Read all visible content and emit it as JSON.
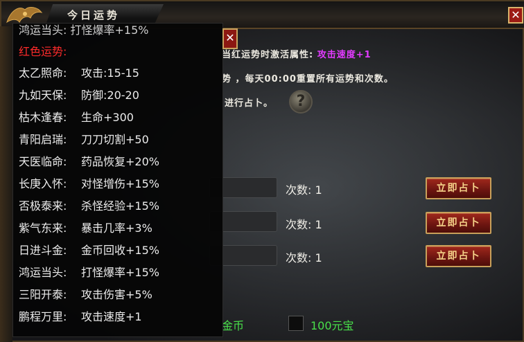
{
  "window": {
    "title": "今日运势",
    "close_symbol": "✕"
  },
  "description": {
    "line1_prefix": "当红运势时激活属性:",
    "line1_highlight": "攻击速度+1",
    "line2": "势 ，每天00:00重置所有运势和次数。",
    "line3": "进行占卜。",
    "help_symbol": "?"
  },
  "divination_rows": [
    {
      "count_label": "次数:",
      "count_value": "1",
      "button_label": "立即占卜"
    },
    {
      "count_label": "次数:",
      "count_value": "1",
      "button_label": "立即占卜"
    },
    {
      "count_label": "次数:",
      "count_value": "1",
      "button_label": "立即占卜"
    }
  ],
  "bottom": {
    "gold_label": "金币",
    "yuanbao_label": "100元宝"
  },
  "tooltip": {
    "close_symbol": "✕",
    "cut_top": "鸿运当头: 打怪爆率+15%",
    "header": "红色运势:",
    "items": [
      {
        "name": "太乙照命:",
        "effect": "攻击:15-15"
      },
      {
        "name": "九如天保:",
        "effect": "防御:20-20"
      },
      {
        "name": "枯木逢春:",
        "effect": "生命+300"
      },
      {
        "name": "青阳启瑞:",
        "effect": "刀刀切割+50"
      },
      {
        "name": "天医临命:",
        "effect": "药品恢复+20%"
      },
      {
        "name": "长庚入怀:",
        "effect": "对怪增伤+15%"
      },
      {
        "name": "否极泰来:",
        "effect": "杀怪经验+15%"
      },
      {
        "name": "紫气东来:",
        "effect": "暴击几率+3%"
      },
      {
        "name": "日进斗金:",
        "effect": "金币回收+15%"
      },
      {
        "name": "鸿运当头:",
        "effect": "打怪爆率+15%"
      },
      {
        "name": "三阳开泰:",
        "effect": "攻击伤害+5%"
      },
      {
        "name": "鹏程万里:",
        "effect": "攻击速度+1"
      }
    ]
  },
  "colors": {
    "highlight": "#e23bff",
    "red_header": "#ff2b2b",
    "green_text": "#49e04a",
    "button_red": "#8c1812"
  }
}
